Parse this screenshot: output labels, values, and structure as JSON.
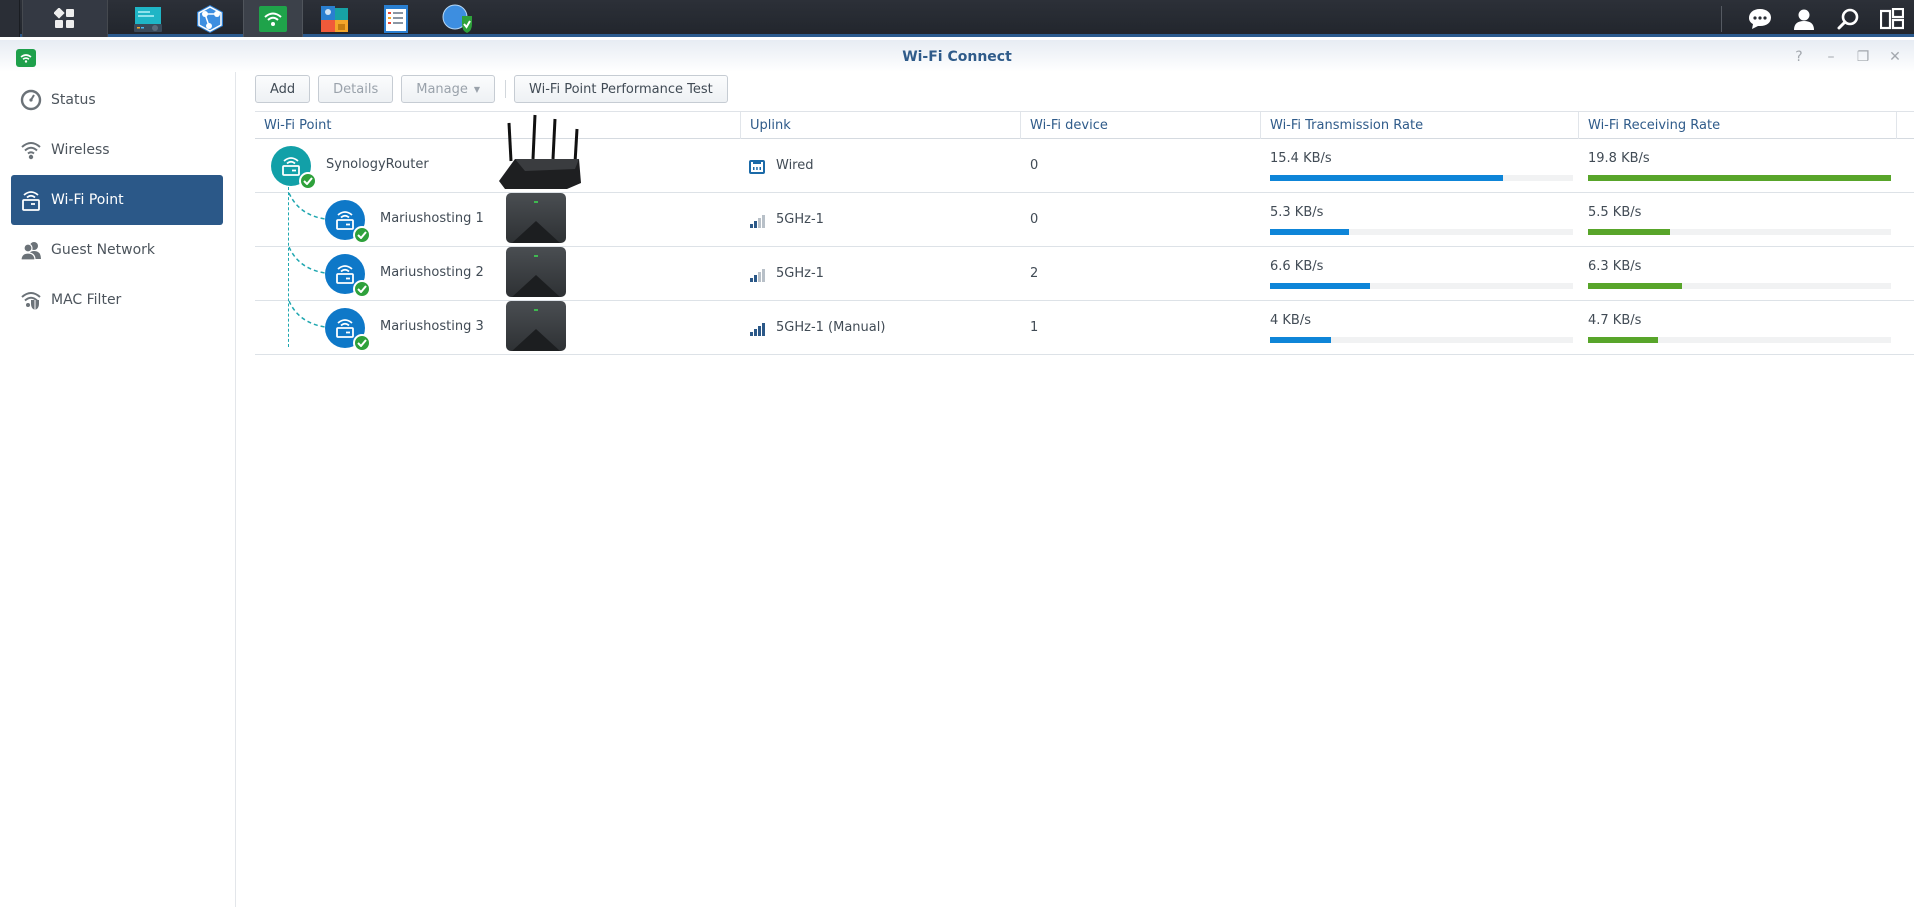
{
  "taskbar": {
    "left_icons": [
      {
        "name": "main-menu-icon",
        "active": false
      },
      {
        "name": "network-center-icon",
        "active": false
      },
      {
        "name": "network-topology-icon",
        "active": false
      },
      {
        "name": "wifi-connect-icon",
        "active": true
      },
      {
        "name": "safe-access-icon",
        "active": false
      },
      {
        "name": "log-center-icon",
        "active": false
      },
      {
        "name": "threat-prevention-icon",
        "active": false
      }
    ],
    "right_icons": [
      "notifications-icon",
      "user-icon",
      "search-icon",
      "widgets-icon"
    ]
  },
  "window": {
    "title": "Wi-Fi Connect",
    "controls": {
      "help": "?",
      "minimize": "–",
      "restore": "❐",
      "close": "✕"
    }
  },
  "sidebar": {
    "items": [
      {
        "label": "Status",
        "icon": "gauge-icon",
        "selected": false
      },
      {
        "label": "Wireless",
        "icon": "wifi-icon",
        "selected": false
      },
      {
        "label": "Wi-Fi Point",
        "icon": "wifi-point-icon",
        "selected": true
      },
      {
        "label": "Guest Network",
        "icon": "guest-users-icon",
        "selected": false
      },
      {
        "label": "MAC Filter",
        "icon": "mac-filter-icon",
        "selected": false
      }
    ]
  },
  "toolbar": {
    "add_label": "Add",
    "details_label": "Details",
    "manage_label": "Manage",
    "performance_test_label": "Wi-Fi Point Performance Test"
  },
  "grid": {
    "columns": [
      "Wi-Fi Point",
      "Uplink",
      "Wi-Fi device",
      "Wi-Fi Transmission Rate",
      "Wi-Fi Receiving Rate"
    ],
    "rows": [
      {
        "name": "SynologyRouter",
        "type": "router",
        "status": "ok",
        "uplink": "Wired",
        "uplink_icon": "ethernet-icon",
        "signal_bars": null,
        "devices": "0",
        "tx": "15.4 KB/s",
        "tx_fraction": 0.77,
        "rx": "19.8 KB/s",
        "rx_fraction": 1.0
      },
      {
        "name": "Mariushosting 1",
        "type": "point",
        "status": "ok",
        "uplink": "5GHz-1",
        "uplink_icon": "signal-icon",
        "signal_bars": 2,
        "devices": "0",
        "tx": "5.3 KB/s",
        "tx_fraction": 0.26,
        "rx": "5.5 KB/s",
        "rx_fraction": 0.27
      },
      {
        "name": "Mariushosting 2",
        "type": "point",
        "status": "ok",
        "uplink": "5GHz-1",
        "uplink_icon": "signal-icon",
        "signal_bars": 2,
        "devices": "2",
        "tx": "6.6 KB/s",
        "tx_fraction": 0.33,
        "rx": "6.3 KB/s",
        "rx_fraction": 0.31
      },
      {
        "name": "Mariushosting 3",
        "type": "point",
        "status": "ok",
        "uplink": "5GHz-1 (Manual)",
        "uplink_icon": "signal-icon",
        "signal_bars": 4,
        "devices": "1",
        "tx": "4 KB/s",
        "tx_fraction": 0.2,
        "rx": "4.7 KB/s",
        "rx_fraction": 0.23
      }
    ]
  },
  "colors": {
    "accent": "#2b5888",
    "tx_bar": "#0e85d8",
    "rx_bar": "#58a52a",
    "router_node": "#12a0a8",
    "point_node": "#0e78c8",
    "status_ok": "#2ea13b"
  }
}
